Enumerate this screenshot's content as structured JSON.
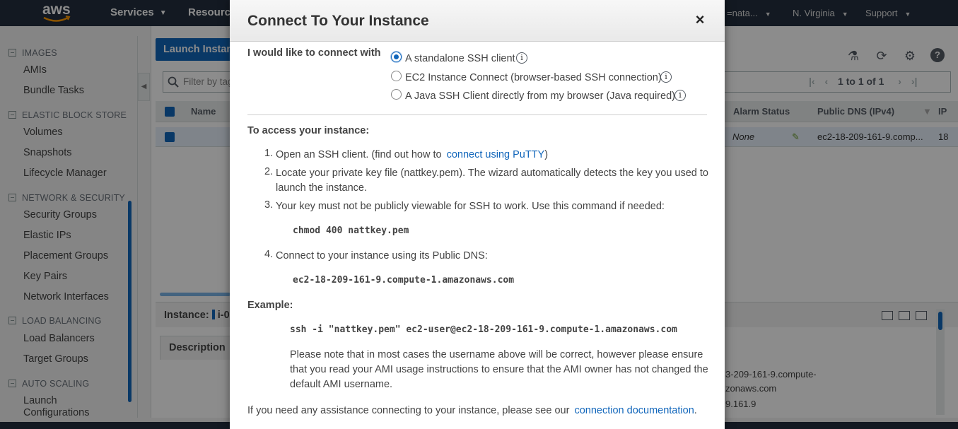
{
  "topnav": {
    "logo": "aws",
    "services": "Services",
    "resources": "Resource",
    "account": "=nata...",
    "region": "N. Virginia",
    "support": "Support"
  },
  "sidebar": {
    "sections": [
      {
        "title": "IMAGES",
        "items": [
          "AMIs",
          "Bundle Tasks"
        ]
      },
      {
        "title": "ELASTIC BLOCK STORE",
        "items": [
          "Volumes",
          "Snapshots",
          "Lifecycle Manager"
        ]
      },
      {
        "title": "NETWORK & SECURITY",
        "items": [
          "Security Groups",
          "Elastic IPs",
          "Placement Groups",
          "Key Pairs",
          "Network Interfaces"
        ]
      },
      {
        "title": "LOAD BALANCING",
        "items": [
          "Load Balancers",
          "Target Groups"
        ]
      },
      {
        "title": "AUTO SCALING",
        "items": [
          "Launch Configurations"
        ]
      }
    ]
  },
  "main": {
    "launch_button": "Launch Instan",
    "filter_placeholder": "Filter by tag",
    "pager_text": "1 to 1 of 1",
    "columns": {
      "name": "Name",
      "alarm": "Alarm Status",
      "dns": "Public DNS (IPv4)",
      "ip": "IP"
    },
    "row": {
      "alarm": "None",
      "dns": "ec2-18-209-161-9.comp...",
      "ip": "18"
    },
    "instance_label": "Instance:",
    "instance_id": "i-0",
    "tab_description": "Description",
    "detail_dns_1": "3-209-161-9.compute-",
    "detail_dns_2": "zonaws.com",
    "detail_ip": "9.161.9"
  },
  "modal": {
    "title": "Connect To Your Instance",
    "connect_with_label": "I would like to connect with",
    "options": [
      {
        "label": "A standalone SSH client",
        "selected": true
      },
      {
        "label": "EC2 Instance Connect (browser-based SSH connection)",
        "selected": false
      },
      {
        "label": "A Java SSH Client directly from my browser (Java required)",
        "selected": false
      }
    ],
    "access_heading": "To access your instance:",
    "step1_text": "Open an SSH client. (find out how to",
    "step1_link": "connect using PuTTY",
    "step1_end": ")",
    "step2_line1": "Locate your private key file (nattkey.pem). The wizard automatically detects the key you used to",
    "step2_line2": "launch the instance.",
    "step3_text": "Your key must not be publicly viewable for SSH to work. Use this command if needed:",
    "step3_cmd": "chmod 400 nattkey.pem",
    "step4_text": "Connect to your instance using its Public DNS:",
    "step4_dns": "ec2-18-209-161-9.compute-1.amazonaws.com",
    "example_heading": "Example:",
    "example_cmd": "ssh -i \"nattkey.pem\" ec2-user@ec2-18-209-161-9.compute-1.amazonaws.com",
    "note_line1": "Please note that in most cases the username above will be correct, however please ensure",
    "note_line2": "that you read your AMI usage instructions to ensure that the AMI owner has not changed the",
    "note_line3": "default AMI username.",
    "help_text": "If you need any assistance connecting to your instance, please see our",
    "help_link": "connection documentation",
    "help_end": ".",
    "numbers": [
      "1.",
      "2.",
      "3.",
      "4."
    ],
    "close_symbol": "×",
    "info_symbol": "i"
  },
  "colors": {
    "nav_bg": "#232f3e",
    "link": "#1166bb",
    "primary_button": "#1166bb"
  },
  "icons": [
    "close-icon",
    "info-icon",
    "beaker-icon",
    "refresh-icon",
    "gear-icon",
    "help-icon",
    "search-icon",
    "pager-first-icon",
    "pager-prev-icon",
    "pager-next-icon",
    "pager-last-icon",
    "chevron-left-icon",
    "caret-down-icon"
  ]
}
